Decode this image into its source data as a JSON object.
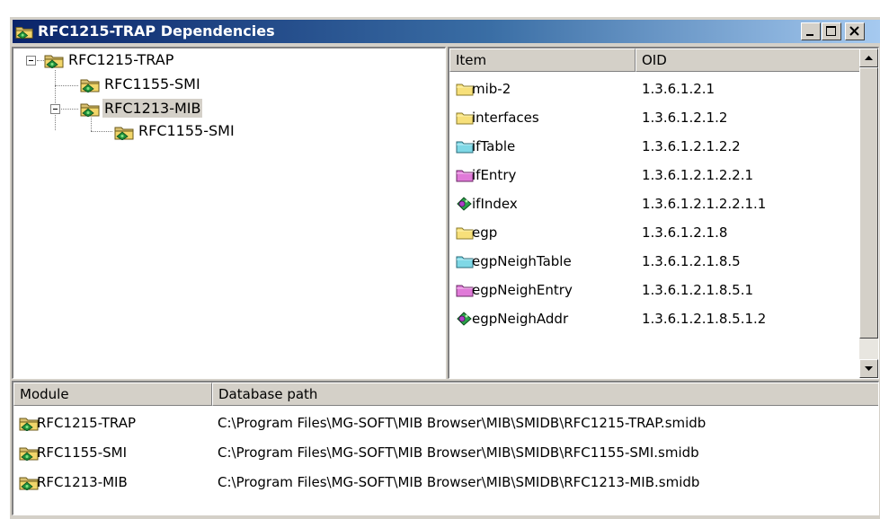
{
  "window": {
    "title": "RFC1215-TRAP Dependencies"
  },
  "tree": {
    "items": [
      {
        "label": "RFC1215-TRAP"
      },
      {
        "label": "RFC1155-SMI"
      },
      {
        "label": "RFC1213-MIB"
      },
      {
        "label": "RFC1155-SMI"
      }
    ]
  },
  "oid_table": {
    "headers": {
      "item": "Item",
      "oid": "OID"
    },
    "rows": [
      {
        "name": "mib-2",
        "oid": "1.3.6.1.2.1",
        "icon": "yellow-folder-icon"
      },
      {
        "name": "interfaces",
        "oid": "1.3.6.1.2.1.2",
        "icon": "yellow-folder-icon"
      },
      {
        "name": "ifTable",
        "oid": "1.3.6.1.2.1.2.2",
        "icon": "cyan-table-folder-icon"
      },
      {
        "name": "ifEntry",
        "oid": "1.3.6.1.2.1.2.2.1",
        "icon": "magenta-entry-folder-icon"
      },
      {
        "name": "ifIndex",
        "oid": "1.3.6.1.2.1.2.2.1.1",
        "icon": "leaf-object-icon"
      },
      {
        "name": "egp",
        "oid": "1.3.6.1.2.1.8",
        "icon": "yellow-folder-icon"
      },
      {
        "name": "egpNeighTable",
        "oid": "1.3.6.1.2.1.8.5",
        "icon": "cyan-table-folder-icon"
      },
      {
        "name": "egpNeighEntry",
        "oid": "1.3.6.1.2.1.8.5.1",
        "icon": "magenta-entry-folder-icon"
      },
      {
        "name": "egpNeighAddr",
        "oid": "1.3.6.1.2.1.8.5.1.2",
        "icon": "leaf-object-icon"
      }
    ]
  },
  "module_table": {
    "headers": {
      "module": "Module",
      "path": "Database path"
    },
    "rows": [
      {
        "module": "RFC1215-TRAP",
        "path": "C:\\Program Files\\MG-SOFT\\MIB Browser\\MIB\\SMIDB\\RFC1215-TRAP.smidb"
      },
      {
        "module": "RFC1155-SMI",
        "path": "C:\\Program Files\\MG-SOFT\\MIB Browser\\MIB\\SMIDB\\RFC1155-SMI.smidb"
      },
      {
        "module": "RFC1213-MIB",
        "path": "C:\\Program Files\\MG-SOFT\\MIB Browser\\MIB\\SMIDB\\RFC1213-MIB.smidb"
      }
    ]
  },
  "colors": {
    "title_gradient_start": "#0a246a",
    "title_gradient_end": "#a6caf0",
    "face": "#d4d0c8",
    "folder_yellow": "#f7e07a",
    "folder_cyan": "#7fd8e6",
    "folder_magenta": "#e07ad8"
  }
}
